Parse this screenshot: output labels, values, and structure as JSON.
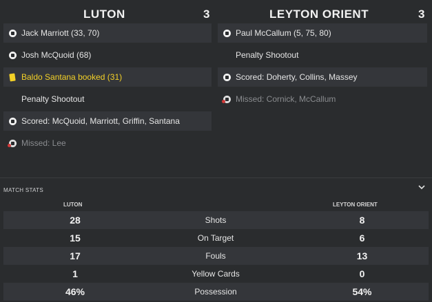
{
  "home": {
    "name": "LUTON",
    "score": "3",
    "events": [
      {
        "icon": "goal-ball-icon",
        "text": "Jack Marriott (33, 70)",
        "style": "shade"
      },
      {
        "icon": "goal-ball-icon",
        "text": "Josh McQuoid (68)",
        "style": "plain"
      },
      {
        "icon": "yellow-card-icon",
        "text": "Baldo Santana booked (31)",
        "style": "shade yellow"
      },
      {
        "icon": "",
        "text": "Penalty Shootout",
        "style": "plain"
      },
      {
        "icon": "goal-ball-icon",
        "text": "Scored: McQuoid, Marriott, Griffin, Santana",
        "style": "shade"
      },
      {
        "icon": "missed-penalty-icon",
        "text": "Missed: Lee",
        "style": "plain missed"
      }
    ]
  },
  "away": {
    "name": "LEYTON ORIENT",
    "score": "3",
    "events": [
      {
        "icon": "goal-ball-icon",
        "text": "Paul McCallum (5, 75, 80)",
        "style": "shade"
      },
      {
        "icon": "",
        "text": "Penalty Shootout",
        "style": "plain"
      },
      {
        "icon": "goal-ball-icon",
        "text": "Scored: Doherty, Collins, Massey",
        "style": "shade"
      },
      {
        "icon": "missed-penalty-icon",
        "text": "Missed: Cornick, McCallum",
        "style": "plain missed"
      }
    ]
  },
  "stats": {
    "title": "MATCH STATS",
    "home_label": "LUTON",
    "away_label": "LEYTON ORIENT",
    "rows": [
      {
        "home": "28",
        "label": "Shots",
        "away": "8"
      },
      {
        "home": "15",
        "label": "On Target",
        "away": "6"
      },
      {
        "home": "17",
        "label": "Fouls",
        "away": "13"
      },
      {
        "home": "1",
        "label": "Yellow Cards",
        "away": "0"
      },
      {
        "home": "46%",
        "label": "Possession",
        "away": "54%"
      }
    ]
  }
}
